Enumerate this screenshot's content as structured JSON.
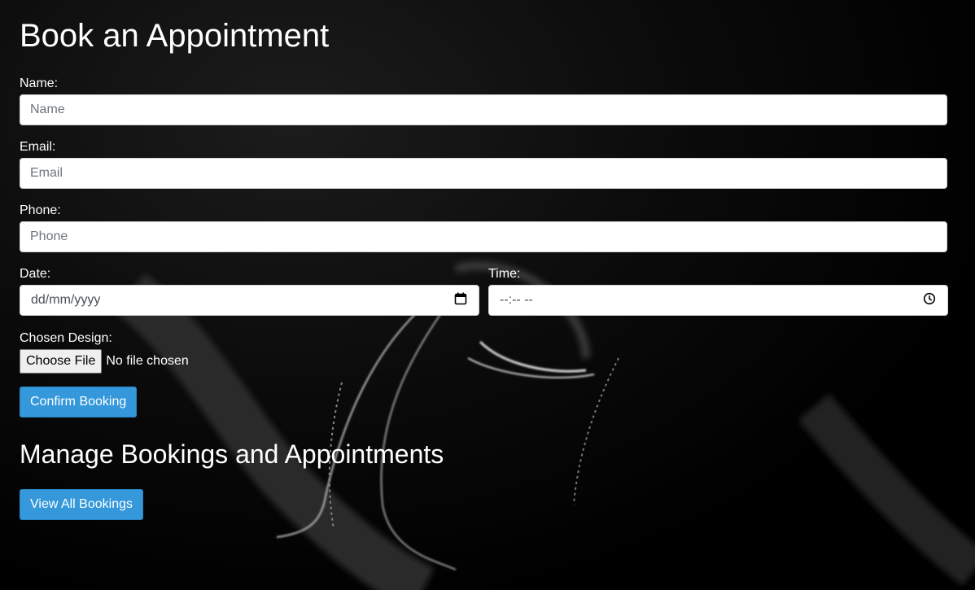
{
  "page": {
    "title": "Book an Appointment",
    "manage_title": "Manage Bookings and Appointments"
  },
  "form": {
    "name_label": "Name:",
    "name_placeholder": "Name",
    "email_label": "Email:",
    "email_placeholder": "Email",
    "phone_label": "Phone:",
    "phone_placeholder": "Phone",
    "date_label": "Date:",
    "date_placeholder": "dd/mm/yyyy",
    "time_label": "Time:",
    "time_placeholder": "--:-- --",
    "design_label": "Chosen Design:",
    "file_button": "Choose File",
    "file_status": "No file chosen",
    "submit_label": "Confirm Booking"
  },
  "manage": {
    "view_all_label": "View All Bookings"
  },
  "icons": {
    "date": "calendar-icon",
    "time": "clock-icon"
  },
  "colors": {
    "accent": "#3498db",
    "background": "#000000"
  }
}
